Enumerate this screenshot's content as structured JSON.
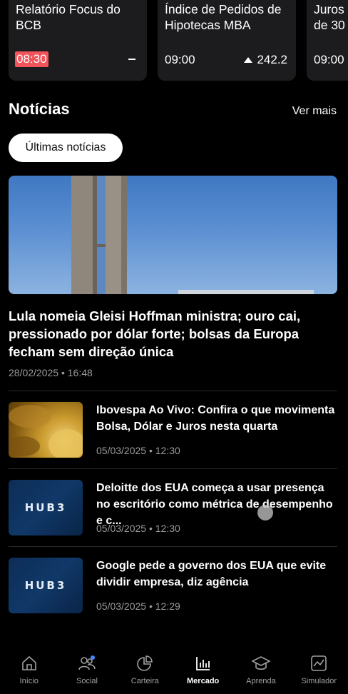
{
  "events": [
    {
      "title": "Relatório Focus do BCB",
      "time": "08:30",
      "value": ""
    },
    {
      "title": "Índice de Pedidos de Hipotecas MBA",
      "time": "09:00",
      "value": "242.2"
    },
    {
      "title": "Juros de 30",
      "time": "09:00",
      "value": ""
    }
  ],
  "news": {
    "title": "Notícias",
    "see_more": "Ver mais",
    "filter_chip": "Últimas notícias",
    "featured": {
      "headline": "Lula nomeia Gleisi Hoffman ministra; ouro cai, pressionado por dólar forte; bolsas da Europa fecham sem direção única",
      "date": "28/02/2025 • 16:48"
    },
    "items": [
      {
        "title": "Ibovespa Ao Vivo: Confira o que movimenta Bolsa, Dólar e Juros nesta quarta",
        "date": "05/03/2025 • 12:30",
        "thumb_text": ""
      },
      {
        "title": "Deloitte dos EUA começa a usar presença no escritório como métrica de desempenho e c...",
        "date": "05/03/2025 • 12:30",
        "thumb_text": "HUB3"
      },
      {
        "title": "Google pede a governo dos EUA que evite dividir empresa, diz agência",
        "date": "05/03/2025 • 12:29",
        "thumb_text": "HUB3"
      }
    ]
  },
  "nav": [
    {
      "label": "Início",
      "icon": "home-icon"
    },
    {
      "label": "Social",
      "icon": "people-icon"
    },
    {
      "label": "Carteira",
      "icon": "pie-chart-icon"
    },
    {
      "label": "Mercado",
      "icon": "bar-chart-icon",
      "active": true
    },
    {
      "label": "Aprenda",
      "icon": "graduation-cap-icon"
    },
    {
      "label": "Simulador",
      "icon": "line-chart-icon"
    }
  ],
  "colors": {
    "live_time_bg": "#f1545a",
    "card_bg": "#1c1c1e",
    "accent_dot": "#3d8bfd"
  }
}
